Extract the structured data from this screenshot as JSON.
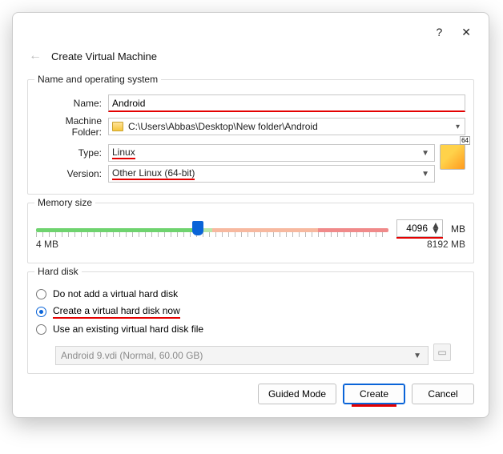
{
  "titlebar": {
    "help": "?",
    "close": "✕"
  },
  "header": {
    "title": "Create Virtual Machine"
  },
  "nameGroup": {
    "legend": "Name and operating system",
    "nameLabel": "Name:",
    "nameValue": "Android",
    "folderLabel": "Machine Folder:",
    "folderPath": "C:\\Users\\Abbas\\Desktop\\New folder\\Android",
    "typeLabel": "Type:",
    "typeValue": "Linux",
    "versionLabel": "Version:",
    "versionValue": "Other Linux (64-bit)",
    "bitBadge": "64"
  },
  "memory": {
    "legend": "Memory size",
    "value": "4096",
    "unit": "MB",
    "minLabel": "4 MB",
    "maxLabel": "8192 MB"
  },
  "disk": {
    "legend": "Hard disk",
    "opt1": "Do not add a virtual hard disk",
    "opt2": "Create a virtual hard disk now",
    "opt3": "Use an existing virtual hard disk file",
    "existingValue": "Android 9.vdi (Normal, 60.00 GB)"
  },
  "buttons": {
    "guided": "Guided Mode",
    "create": "Create",
    "cancel": "Cancel"
  }
}
